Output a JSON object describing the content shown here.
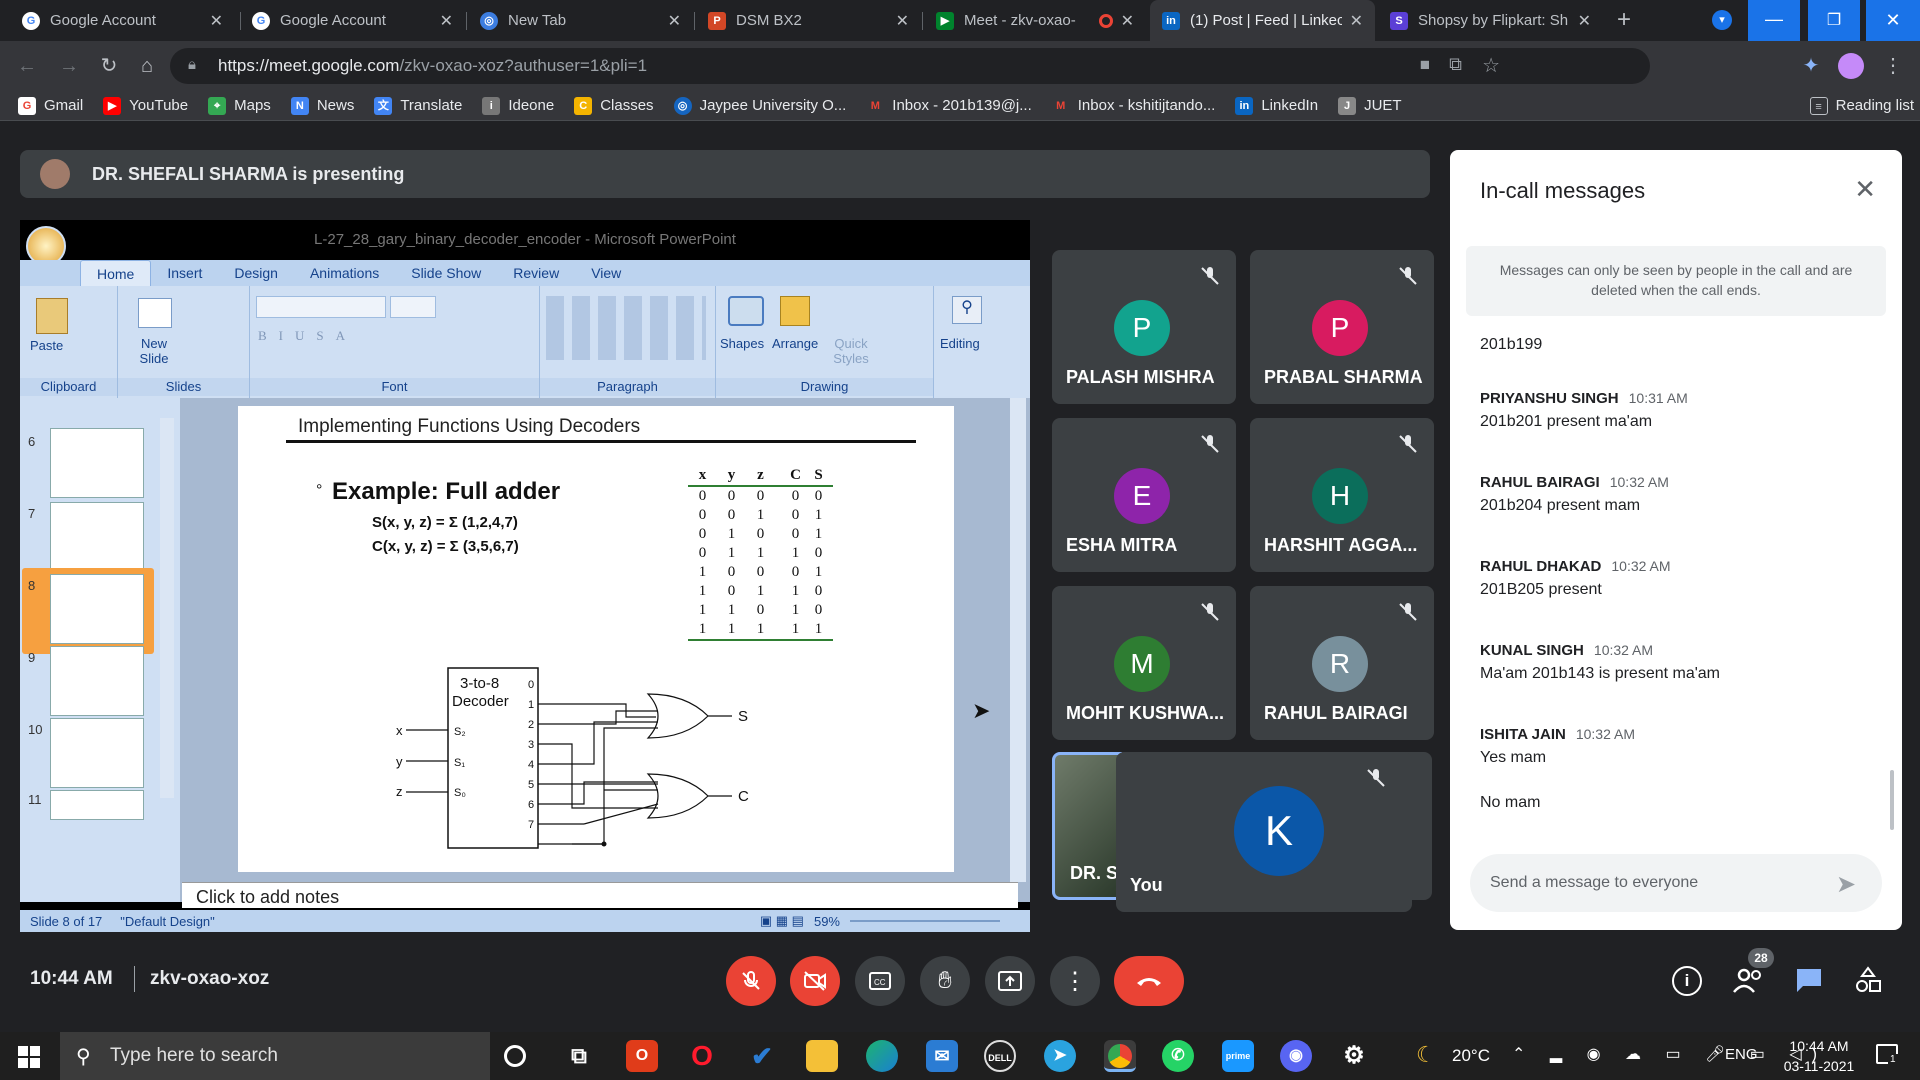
{
  "browser": {
    "tabs": [
      {
        "label": "Google Account",
        "icon": "google-icon"
      },
      {
        "label": "Google Account",
        "icon": "google-icon"
      },
      {
        "label": "New Tab",
        "icon": "chrome-icon"
      },
      {
        "label": "DSM BX2",
        "icon": "powerpoint-icon"
      },
      {
        "label": "Meet - zkv-oxao-",
        "icon": "meet-icon"
      },
      {
        "label": "(1) Post | Feed | Linkec",
        "icon": "linkedin-icon"
      },
      {
        "label": "Shopsy by Flipkart: Sh",
        "icon": "shopsy-icon"
      }
    ],
    "new_tab": "+",
    "url_host": "https://meet.google.com",
    "url_path": "/zkv-oxao-xoz?authuser=1&pli=1",
    "bookmarks": [
      {
        "label": "Gmail"
      },
      {
        "label": "YouTube"
      },
      {
        "label": "Maps"
      },
      {
        "label": "News"
      },
      {
        "label": "Translate"
      },
      {
        "label": "Ideone"
      },
      {
        "label": "Classes"
      },
      {
        "label": "Jaypee University O..."
      },
      {
        "label": "Inbox - 201b139@j..."
      },
      {
        "label": "Inbox - kshitijtando..."
      },
      {
        "label": "LinkedIn"
      },
      {
        "label": "JUET"
      }
    ],
    "reading_list": "Reading list"
  },
  "meet": {
    "presenting": "DR. SHEFALI SHARMA is presenting",
    "time": "10:44 AM",
    "meeting_code": "zkv-oxao-xoz",
    "participant_count": "28",
    "tiles": [
      {
        "initial": "P",
        "name": "PALASH MISHRA",
        "color": "#12a38e"
      },
      {
        "initial": "P",
        "name": "PRABAL SHARMA",
        "color": "#d81b60"
      },
      {
        "initial": "E",
        "name": "ESHA MITRA",
        "color": "#8e24aa"
      },
      {
        "initial": "H",
        "name": "HARSHIT AGGA...",
        "color": "#0b6e5b"
      },
      {
        "initial": "M",
        "name": "MOHIT KUSHWA...",
        "color": "#2e7d32"
      },
      {
        "initial": "R",
        "name": "RAHUL BAIRAGI",
        "color": "#78909c"
      }
    ],
    "presenter_tile": "DR. SI",
    "self_tile": {
      "initial": "K",
      "name": "You",
      "color": "#0b57a8"
    }
  },
  "powerpoint": {
    "title": "L-27_28_gary_binary_decoder_encoder - Microsoft PowerPoint",
    "tabs": [
      "Home",
      "Insert",
      "Design",
      "Animations",
      "Slide Show",
      "Review",
      "View"
    ],
    "groups": [
      "Clipboard",
      "Slides",
      "Font",
      "Paragraph",
      "Drawing"
    ],
    "buttons": {
      "paste": "Paste",
      "new_slide": "New Slide",
      "shapes": "Shapes",
      "arrange": "Arrange",
      "quick_styles": "Quick Styles",
      "editing": "Editing"
    },
    "slide_numbers": [
      "6",
      "7",
      "8",
      "9",
      "10",
      "11"
    ],
    "notes": "Click to add notes",
    "status": "Slide 8 of 17",
    "design": "\"Default Design\"",
    "zoom": "59%"
  },
  "slide": {
    "title": "Implementing Functions Using Decoders",
    "example": "Example:  Full adder",
    "eq_s": "S(x, y, z) = Σ (1,2,4,7)",
    "eq_c": "C(x, y, z) = Σ (3,5,6,7)",
    "truth_headers": [
      "x",
      "y",
      "z",
      "C",
      "S"
    ],
    "truth_rows": [
      [
        "0",
        "0",
        "0",
        "0",
        "0"
      ],
      [
        "0",
        "0",
        "1",
        "0",
        "1"
      ],
      [
        "0",
        "1",
        "0",
        "0",
        "1"
      ],
      [
        "0",
        "1",
        "1",
        "1",
        "0"
      ],
      [
        "1",
        "0",
        "0",
        "0",
        "1"
      ],
      [
        "1",
        "0",
        "1",
        "1",
        "0"
      ],
      [
        "1",
        "1",
        "0",
        "1",
        "0"
      ],
      [
        "1",
        "1",
        "1",
        "1",
        "1"
      ]
    ],
    "decoder_label_1": "3-to-8",
    "decoder_label_2": "Decoder",
    "inputs": [
      "x",
      "y",
      "z"
    ],
    "selects": [
      "S₂",
      "S₁",
      "S₀"
    ],
    "outputs": [
      "0",
      "1",
      "2",
      "3",
      "4",
      "5",
      "6",
      "7"
    ],
    "out_s": "S",
    "out_c": "C"
  },
  "chat": {
    "title": "In-call messages",
    "notice": "Messages can only be seen by people in the call and are deleted when the call ends.",
    "messages": [
      {
        "sender": "",
        "time": "",
        "text": "201b199"
      },
      {
        "sender": "PRIYANSHU SINGH",
        "time": "10:31 AM",
        "text": "201b201 present ma'am"
      },
      {
        "sender": "RAHUL BAIRAGI",
        "time": "10:32 AM",
        "text": "201b204 present mam"
      },
      {
        "sender": "RAHUL DHAKAD",
        "time": "10:32 AM",
        "text": "201B205 present"
      },
      {
        "sender": "KUNAL SINGH",
        "time": "10:32 AM",
        "text": "Ma'am 201b143  is present ma'am"
      },
      {
        "sender": "ISHITA JAIN",
        "time": "10:32 AM",
        "text": "Yes mam"
      },
      {
        "sender": "",
        "time": "",
        "text": "No mam"
      }
    ],
    "placeholder": "Send a message to everyone"
  },
  "taskbar": {
    "search_placeholder": "Type here to search",
    "weather": "20°C",
    "language": "ENG",
    "clock_time": "10:44 AM",
    "clock_date": "03-11-2021",
    "notif_count": "1"
  }
}
